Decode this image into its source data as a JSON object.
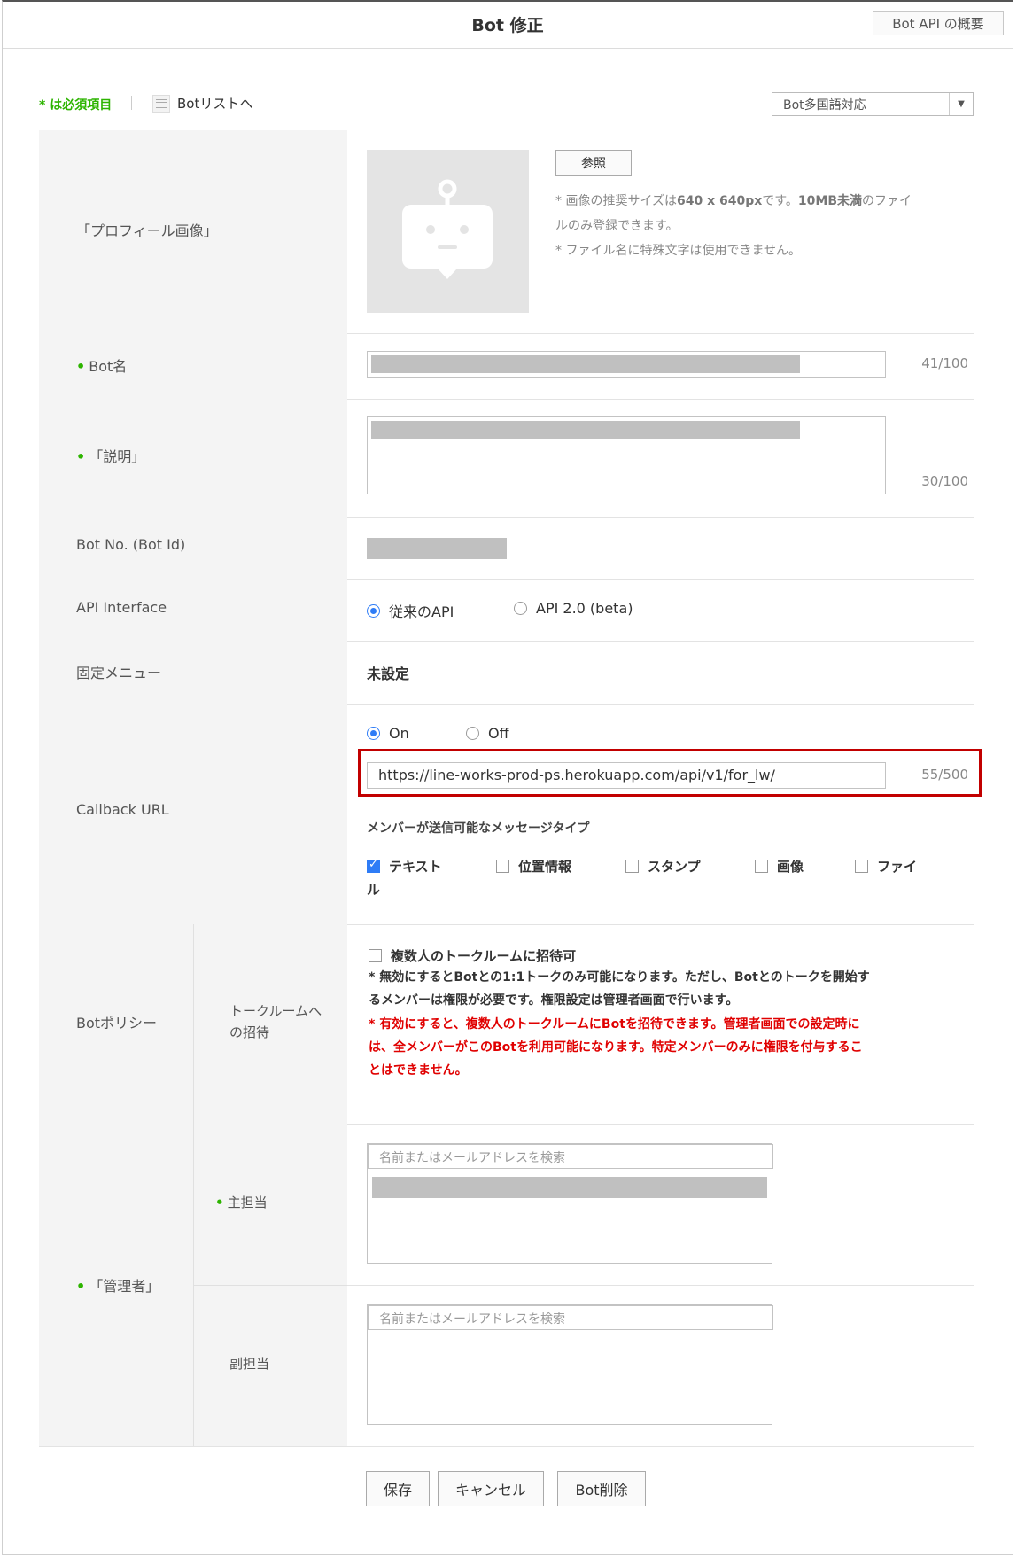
{
  "header": {
    "title": "Bot 修正",
    "api_overview_button": "Bot API の概要"
  },
  "toolbar": {
    "required_note": "* は必須項目",
    "bot_list_link": "Botリストへ",
    "language_select": "Bot多国語対応"
  },
  "profile": {
    "label": "「プロフィール画像」",
    "browse_button": "参照",
    "note_line1_prefix": "* 画像の推奨サイズは",
    "note_line1_bold": "640 x 640px",
    "note_line1_mid": "です。",
    "note_line1_bold2": "10MB未満",
    "note_line1_suffix": "のファイ",
    "note_line2": "ルのみ登録できます。",
    "note_line3": "* ファイル名に特殊文字は使用できません。"
  },
  "bot_name": {
    "label": "Bot名",
    "counter": "41/100"
  },
  "description": {
    "label": "「説明」",
    "counter": "30/100"
  },
  "bot_no": {
    "label": "Bot No. (Bot Id)"
  },
  "api_interface": {
    "label": "API Interface",
    "option_legacy": "従来のAPI",
    "option_v2": "API 2.0 (beta)",
    "selected": "従来のAPI"
  },
  "fixed_menu": {
    "label": "固定メニュー",
    "value": "未設定"
  },
  "callback": {
    "label": "Callback URL",
    "option_on": "On",
    "option_off": "Off",
    "selected": "On",
    "url": "https://line-works-prod-ps.herokuapp.com/api/v1/for_lw/",
    "counter": "55/500",
    "message_types_title": "メンバーが送信可能なメッセージタイプ",
    "types": [
      {
        "label": "テキスト",
        "checked": true
      },
      {
        "label": "位置情報",
        "checked": false
      },
      {
        "label": "スタンプ",
        "checked": false
      },
      {
        "label": "画像",
        "checked": false
      },
      {
        "label": "ファイ",
        "checked": false
      }
    ],
    "types_overflow": "ル"
  },
  "policy": {
    "label": "Botポリシー",
    "sub_label_line1": "トークルームへ",
    "sub_label_line2": "の招待",
    "checkbox_label": "複数人のトークルームに招待可",
    "checked": false,
    "note_line1": "* 無効にするとBotとの1:1トークのみ可能になります。ただし、Botとのトークを開始す",
    "note_line2": "るメンバーは権限が必要です。権限設定は管理者画面で行います。",
    "red_line1": "* 有効にすると、複数人のトークルームにBotを招待できます。管理者画面での設定時に",
    "red_line2": "は、全メンバーがこのBotを利用可能になります。特定メンバーのみに権限を付与するこ",
    "red_line3": "とはできません。"
  },
  "admin": {
    "label": "「管理者」",
    "primary_label": "主担当",
    "secondary_label": "副担当",
    "search_placeholder": "名前またはメールアドレスを検索"
  },
  "footer": {
    "save": "保存",
    "cancel": "キャンセル",
    "delete": "Bot削除"
  },
  "colors": {
    "required_green": "#2db400",
    "radio_blue": "#2e7cf6",
    "warning_red": "#e00000",
    "highlight_red": "#c20000"
  }
}
